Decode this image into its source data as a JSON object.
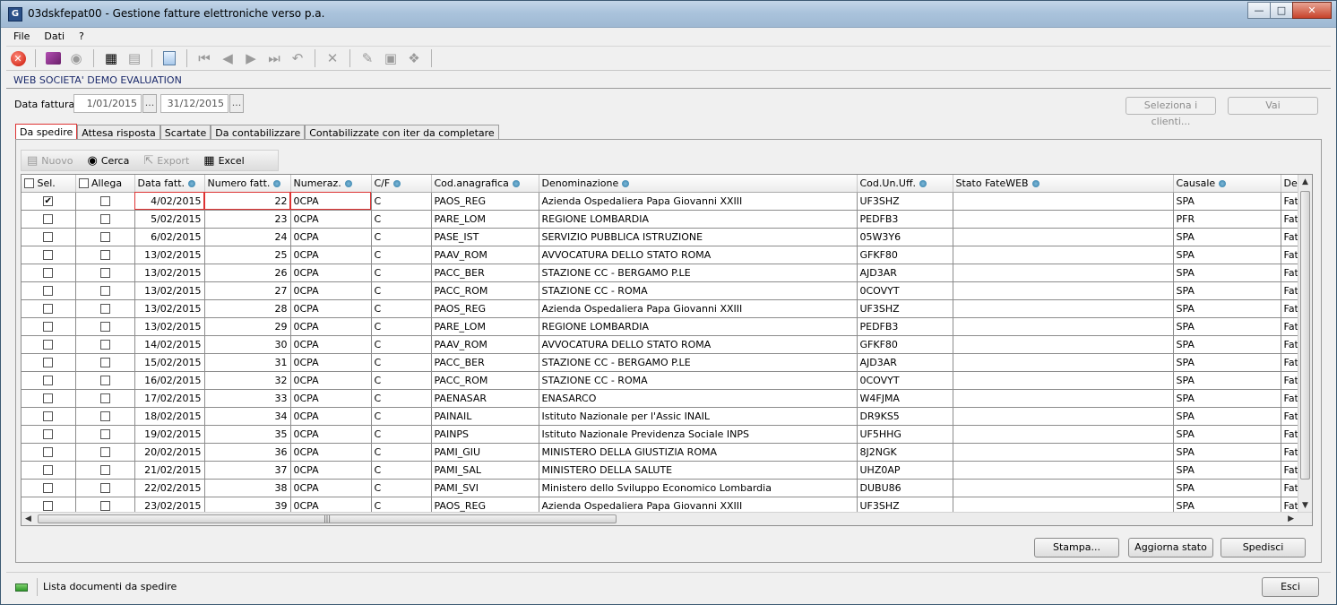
{
  "window": {
    "title": "03dskfepat00 - Gestione fatture elettroniche verso p.a.",
    "icon": "G"
  },
  "menu": [
    "File",
    "Dati",
    "?"
  ],
  "company": "WEB SOCIETA' DEMO EVALUATION",
  "filter": {
    "label": "Data fattura",
    "from": "1/01/2015",
    "to": "31/12/2015",
    "picker": "...",
    "select_clients": "Seleziona i clienti...",
    "go": "Vai"
  },
  "tabs": [
    "Da spedire",
    "Attesa risposta",
    "Scartate",
    "Da contabilizzare",
    "Contabilizzate con iter da completare"
  ],
  "gridtoolbar": {
    "new": "Nuovo",
    "search": "Cerca",
    "export": "Export",
    "excel": "Excel"
  },
  "columns": [
    "Sel.",
    "Allega",
    "Data fatt.",
    "Numero fatt.",
    "Numeraz.",
    "C/F",
    "Cod.anagrafica",
    "Denominazione",
    "Cod.Un.Uff.",
    "Stato FateWEB",
    "Causale",
    "De"
  ],
  "rows": [
    {
      "sel": true,
      "date": "4/02/2015",
      "num": "22",
      "numeraz": "0CPA",
      "cf": "C",
      "code": "PAOS_REG",
      "name": "Azienda Ospedaliera Papa Giovanni XXIII",
      "uff": "UF3SHZ",
      "stato": "",
      "causale": "SPA",
      "de": "Fat"
    },
    {
      "sel": false,
      "date": "5/02/2015",
      "num": "23",
      "numeraz": "0CPA",
      "cf": "C",
      "code": "PARE_LOM",
      "name": "REGIONE LOMBARDIA",
      "uff": "PEDFB3",
      "stato": "",
      "causale": "PFR",
      "de": "Fat"
    },
    {
      "sel": false,
      "date": "6/02/2015",
      "num": "24",
      "numeraz": "0CPA",
      "cf": "C",
      "code": "PASE_IST",
      "name": "SERVIZIO PUBBLICA ISTRUZIONE",
      "uff": "05W3Y6",
      "stato": "",
      "causale": "SPA",
      "de": "Fat"
    },
    {
      "sel": false,
      "date": "13/02/2015",
      "num": "25",
      "numeraz": "0CPA",
      "cf": "C",
      "code": "PAAV_ROM",
      "name": "AVVOCATURA DELLO STATO ROMA",
      "uff": "GFKF80",
      "stato": "",
      "causale": "SPA",
      "de": "Fat"
    },
    {
      "sel": false,
      "date": "13/02/2015",
      "num": "26",
      "numeraz": "0CPA",
      "cf": "C",
      "code": "PACC_BER",
      "name": "STAZIONE CC - BERGAMO P.LE",
      "uff": "AJD3AR",
      "stato": "",
      "causale": "SPA",
      "de": "Fat"
    },
    {
      "sel": false,
      "date": "13/02/2015",
      "num": "27",
      "numeraz": "0CPA",
      "cf": "C",
      "code": "PACC_ROM",
      "name": "STAZIONE CC - ROMA",
      "uff": "0COVYT",
      "stato": "",
      "causale": "SPA",
      "de": "Fat"
    },
    {
      "sel": false,
      "date": "13/02/2015",
      "num": "28",
      "numeraz": "0CPA",
      "cf": "C",
      "code": "PAOS_REG",
      "name": "Azienda Ospedaliera Papa Giovanni XXIII",
      "uff": "UF3SHZ",
      "stato": "",
      "causale": "SPA",
      "de": "Fat"
    },
    {
      "sel": false,
      "date": "13/02/2015",
      "num": "29",
      "numeraz": "0CPA",
      "cf": "C",
      "code": "PARE_LOM",
      "name": "REGIONE LOMBARDIA",
      "uff": "PEDFB3",
      "stato": "",
      "causale": "SPA",
      "de": "Fat"
    },
    {
      "sel": false,
      "date": "14/02/2015",
      "num": "30",
      "numeraz": "0CPA",
      "cf": "C",
      "code": "PAAV_ROM",
      "name": "AVVOCATURA DELLO STATO ROMA",
      "uff": "GFKF80",
      "stato": "",
      "causale": "SPA",
      "de": "Fat"
    },
    {
      "sel": false,
      "date": "15/02/2015",
      "num": "31",
      "numeraz": "0CPA",
      "cf": "C",
      "code": "PACC_BER",
      "name": "STAZIONE CC - BERGAMO P.LE",
      "uff": "AJD3AR",
      "stato": "",
      "causale": "SPA",
      "de": "Fat"
    },
    {
      "sel": false,
      "date": "16/02/2015",
      "num": "32",
      "numeraz": "0CPA",
      "cf": "C",
      "code": "PACC_ROM",
      "name": "STAZIONE CC - ROMA",
      "uff": "0COVYT",
      "stato": "",
      "causale": "SPA",
      "de": "Fat"
    },
    {
      "sel": false,
      "date": "17/02/2015",
      "num": "33",
      "numeraz": "0CPA",
      "cf": "C",
      "code": "PAENASAR",
      "name": "ENASARCO",
      "uff": "W4FJMA",
      "stato": "",
      "causale": "SPA",
      "de": "Fat"
    },
    {
      "sel": false,
      "date": "18/02/2015",
      "num": "34",
      "numeraz": "0CPA",
      "cf": "C",
      "code": "PAINAIL",
      "name": "Istituto Nazionale per l'Assic INAIL",
      "uff": "DR9KS5",
      "stato": "",
      "causale": "SPA",
      "de": "Fat"
    },
    {
      "sel": false,
      "date": "19/02/2015",
      "num": "35",
      "numeraz": "0CPA",
      "cf": "C",
      "code": "PAINPS",
      "name": "Istituto Nazionale Previdenza Sociale INPS",
      "uff": "UF5HHG",
      "stato": "",
      "causale": "SPA",
      "de": "Fat"
    },
    {
      "sel": false,
      "date": "20/02/2015",
      "num": "36",
      "numeraz": "0CPA",
      "cf": "C",
      "code": "PAMI_GIU",
      "name": "MINISTERO DELLA GIUSTIZIA ROMA",
      "uff": "8J2NGK",
      "stato": "",
      "causale": "SPA",
      "de": "Fat"
    },
    {
      "sel": false,
      "date": "21/02/2015",
      "num": "37",
      "numeraz": "0CPA",
      "cf": "C",
      "code": "PAMI_SAL",
      "name": "MINISTERO DELLA SALUTE",
      "uff": "UHZ0AP",
      "stato": "",
      "causale": "SPA",
      "de": "Fat"
    },
    {
      "sel": false,
      "date": "22/02/2015",
      "num": "38",
      "numeraz": "0CPA",
      "cf": "C",
      "code": "PAMI_SVI",
      "name": "Ministero dello Sviluppo Economico Lombardia",
      "uff": "DUBU86",
      "stato": "",
      "causale": "SPA",
      "de": "Fat"
    },
    {
      "sel": false,
      "date": "23/02/2015",
      "num": "39",
      "numeraz": "0CPA",
      "cf": "C",
      "code": "PAOS_REG",
      "name": "Azienda Ospedaliera Papa Giovanni XXIII",
      "uff": "UF3SHZ",
      "stato": "",
      "causale": "SPA",
      "de": "Fat"
    }
  ],
  "actions": {
    "print": "Stampa...",
    "refresh": "Aggiorna stato",
    "send": "Spedisci",
    "exit": "Esci"
  },
  "status": "Lista documenti da spedire",
  "colors": {
    "accent": "#dd3333",
    "company": "#1b2a6b",
    "led": "#2f9a2a"
  }
}
